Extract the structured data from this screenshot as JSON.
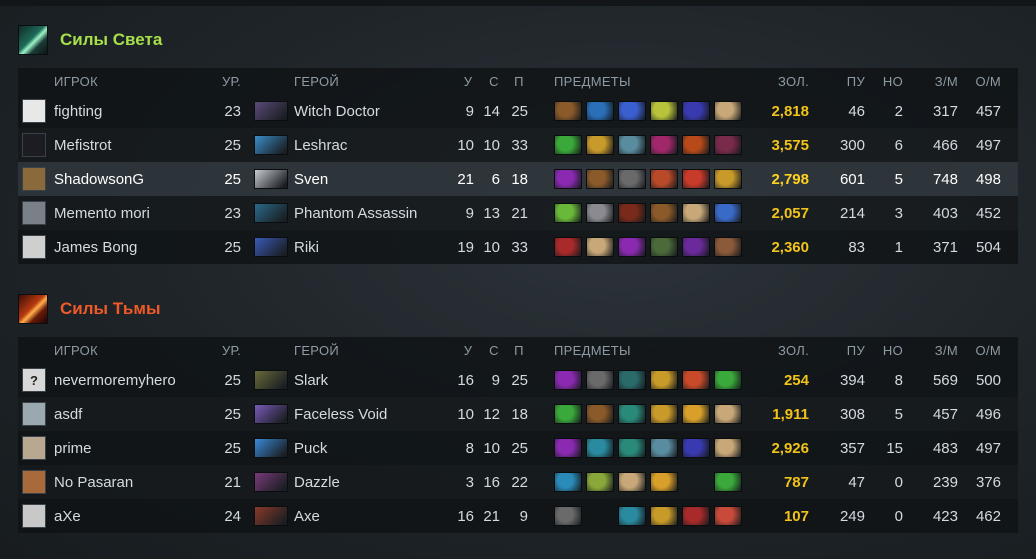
{
  "columns": {
    "player": "ИГРОК",
    "level": "УР.",
    "hero": "ГЕРОЙ",
    "kills": "У",
    "deaths": "С",
    "assists": "П",
    "items": "ПРЕДМЕТЫ",
    "gold": "ЗОЛ.",
    "last_hits": "ПУ",
    "denies": "НО",
    "xpm": "З/М",
    "gpm": "О/М"
  },
  "radiant": {
    "title": "Силы Света",
    "icon": "radiant-faction-icon",
    "color": "#a7e04a",
    "players": [
      {
        "name": "fighting",
        "level": "23",
        "hero": "Witch Doctor",
        "k": "9",
        "d": "14",
        "a": "25",
        "gold": "2,818",
        "lh": "46",
        "dn": "2",
        "xpm": "317",
        "gpm": "457",
        "avatar_color": "#e8e8e8",
        "avatar_glyph": "",
        "hero_color": "#5b4a7a",
        "items": [
          "#8a5a2a",
          "#2a6fb8",
          "#3a5fd0",
          "#b8c23a",
          "#3a3ab0",
          "#c8a878"
        ]
      },
      {
        "name": "Mefistrot",
        "level": "25",
        "hero": "Leshrac",
        "k": "10",
        "d": "10",
        "a": "33",
        "gold": "3,575",
        "lh": "300",
        "dn": "6",
        "xpm": "466",
        "gpm": "497",
        "avatar_color": "#1c1c22",
        "avatar_glyph": "",
        "hero_color": "#3a8ec8",
        "items": [
          "#3aa83a",
          "#c89a2a",
          "#5a8ca0",
          "#a0286a",
          "#b84a1a",
          "#7a2a4a"
        ]
      },
      {
        "name": "ShadowsonG",
        "level": "25",
        "hero": "Sven",
        "k": "21",
        "d": "6",
        "a": "18",
        "gold": "2,798",
        "lh": "601",
        "dn": "5",
        "xpm": "748",
        "gpm": "498",
        "avatar_color": "#8a6a3a",
        "avatar_glyph": "",
        "hero_color": "#c8ccd2",
        "items": [
          "#8a2ab0",
          "#8a5a2a",
          "#6a6a6a",
          "#b84a2a",
          "#c83a2a",
          "#c89a2a"
        ]
      },
      {
        "name": "Memento mori",
        "level": "23",
        "hero": "Phantom Assassin",
        "k": "9",
        "d": "13",
        "a": "21",
        "gold": "2,057",
        "lh": "214",
        "dn": "3",
        "xpm": "403",
        "gpm": "452",
        "avatar_color": "#7a8088",
        "avatar_glyph": "",
        "hero_color": "#2a6a8a",
        "items": [
          "#6ab83a",
          "#8a8a90",
          "#7a2a1a",
          "#8a5a2a",
          "#c8a878",
          "#3a6ac8"
        ]
      },
      {
        "name": "James Bong",
        "level": "25",
        "hero": "Riki",
        "k": "19",
        "d": "10",
        "a": "33",
        "gold": "2,360",
        "lh": "83",
        "dn": "1",
        "xpm": "371",
        "gpm": "504",
        "avatar_color": "#cfcfcf",
        "avatar_glyph": "",
        "hero_color": "#3a5ab8",
        "items": [
          "#a82a2a",
          "#c8a878",
          "#8a2ab0",
          "#4a6a3a",
          "#6a2a9a",
          "#8a5a3a"
        ]
      }
    ]
  },
  "dire": {
    "title": "Силы Тьмы",
    "icon": "dire-faction-icon",
    "color": "#ef5a28",
    "players": [
      {
        "name": "nevermoremyhero",
        "level": "25",
        "hero": "Slark",
        "k": "16",
        "d": "9",
        "a": "25",
        "gold": "254",
        "lh": "394",
        "dn": "8",
        "xpm": "569",
        "gpm": "500",
        "avatar_color": "#d8d8d8",
        "avatar_glyph": "?",
        "hero_color": "#6a6a3a",
        "items": [
          "#8a2ab0",
          "#6a6a6a",
          "#2a6a6a",
          "#c89a2a",
          "#c84a2a",
          "#3aa83a"
        ]
      },
      {
        "name": "asdf",
        "level": "25",
        "hero": "Faceless Void",
        "k": "10",
        "d": "12",
        "a": "18",
        "gold": "1,911",
        "lh": "308",
        "dn": "5",
        "xpm": "457",
        "gpm": "496",
        "avatar_color": "#9aa8b0",
        "avatar_glyph": "",
        "hero_color": "#7a5ab8",
        "items": [
          "#3aa83a",
          "#8a5a2a",
          "#2a8a7a",
          "#c89a2a",
          "#d8a02a",
          "#c8a878"
        ]
      },
      {
        "name": "prime",
        "level": "25",
        "hero": "Puck",
        "k": "8",
        "d": "10",
        "a": "25",
        "gold": "2,926",
        "lh": "357",
        "dn": "15",
        "xpm": "483",
        "gpm": "497",
        "avatar_color": "#b8a890",
        "avatar_glyph": "",
        "hero_color": "#3a8ad8",
        "items": [
          "#8a2ab0",
          "#2a8aa0",
          "#2a8a7a",
          "#5a8ca0",
          "#3a3ab0",
          "#c8a878"
        ]
      },
      {
        "name": "No Pasaran",
        "level": "21",
        "hero": "Dazzle",
        "k": "3",
        "d": "16",
        "a": "22",
        "gold": "787",
        "lh": "47",
        "dn": "0",
        "xpm": "239",
        "gpm": "376",
        "avatar_color": "#a86a3a",
        "avatar_glyph": "",
        "hero_color": "#7a3a7a",
        "items": [
          "#2a8ab8",
          "#8aa83a",
          "#c8a878",
          "#d8a02a",
          "",
          "#3aa83a"
        ]
      },
      {
        "name": "aXe",
        "level": "24",
        "hero": "Axe",
        "k": "16",
        "d": "21",
        "a": "9",
        "gold": "107",
        "lh": "249",
        "dn": "0",
        "xpm": "423",
        "gpm": "462",
        "avatar_color": "#c8c8c8",
        "avatar_glyph": "",
        "hero_color": "#8a3a2a",
        "items": [
          "#6a6a6a",
          "",
          "#2a8aa0",
          "#c89a2a",
          "#a82a2a",
          "#c84a3a"
        ]
      }
    ]
  }
}
